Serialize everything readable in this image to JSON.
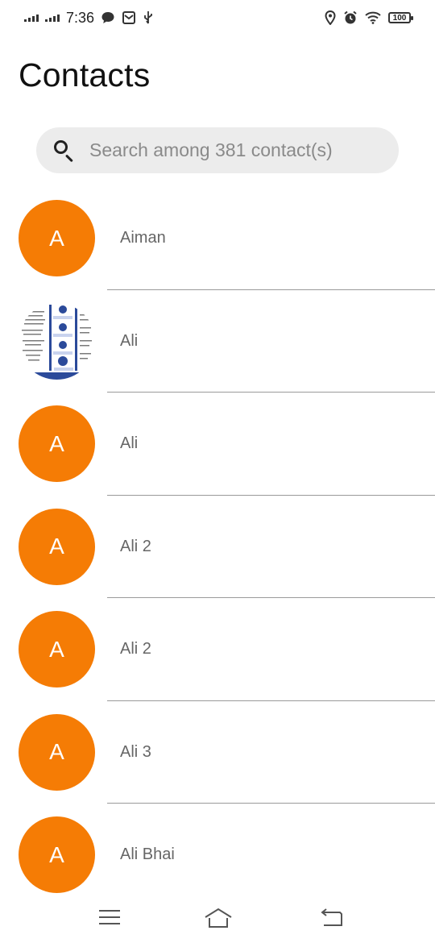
{
  "status_bar": {
    "time": "7:36",
    "battery": "100"
  },
  "header": {
    "title": "Contacts"
  },
  "search": {
    "placeholder": "Search among 381 contact(s)"
  },
  "contacts": [
    {
      "name": "Aiman",
      "initial": "A",
      "avatar": "initial"
    },
    {
      "name": "Ali",
      "initial": "",
      "avatar": "photo"
    },
    {
      "name": "Ali",
      "initial": "A",
      "avatar": "initial"
    },
    {
      "name": "Ali 2",
      "initial": "A",
      "avatar": "initial"
    },
    {
      "name": "Ali 2",
      "initial": "A",
      "avatar": "initial"
    },
    {
      "name": "Ali 3",
      "initial": "A",
      "avatar": "initial"
    },
    {
      "name": "Ali Bhai",
      "initial": "A",
      "avatar": "initial"
    }
  ],
  "colors": {
    "avatar_bg": "#f57c05",
    "search_bg": "#ececec",
    "divider": "#9a9a9a"
  },
  "icons": {
    "nav": [
      "menu-icon",
      "home-icon",
      "back-icon"
    ]
  }
}
